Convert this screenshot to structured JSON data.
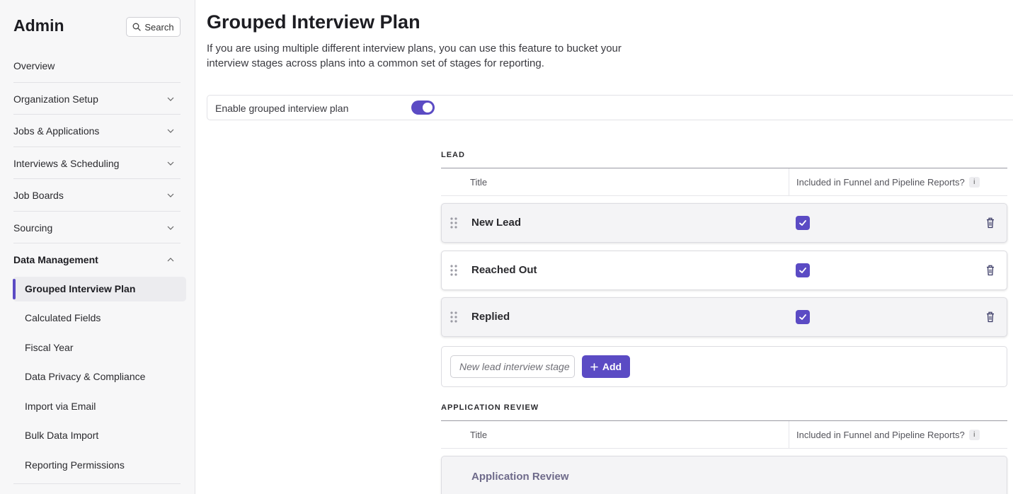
{
  "sidebar": {
    "title": "Admin",
    "search_label": "Search",
    "overview": "Overview",
    "sections": [
      {
        "label": "Organization Setup",
        "expanded": false
      },
      {
        "label": "Jobs & Applications",
        "expanded": false
      },
      {
        "label": "Interviews & Scheduling",
        "expanded": false
      },
      {
        "label": "Job Boards",
        "expanded": false
      },
      {
        "label": "Sourcing",
        "expanded": false
      },
      {
        "label": "Data Management",
        "expanded": true
      }
    ],
    "sub_items": [
      {
        "label": "Grouped Interview Plan",
        "active": true
      },
      {
        "label": "Calculated Fields"
      },
      {
        "label": "Fiscal Year"
      },
      {
        "label": "Data Privacy & Compliance"
      },
      {
        "label": "Import via Email"
      },
      {
        "label": "Bulk Data Import"
      },
      {
        "label": "Reporting Permissions"
      }
    ]
  },
  "main": {
    "title": "Grouped Interview Plan",
    "description": "If you are using multiple different interview plans, you can use this feature to bucket your interview stages across plans into a common set of stages for reporting.",
    "toggle": {
      "label": "Enable grouped interview plan",
      "enabled": true
    },
    "groups": [
      {
        "name": "LEAD",
        "col_title": "Title",
        "col_included": "Included in Funnel and Pipeline Reports?",
        "info_badge": "i",
        "stages": [
          {
            "name": "New Lead",
            "included": true
          },
          {
            "name": "Reached Out",
            "included": true
          },
          {
            "name": "Replied",
            "included": true
          }
        ],
        "add_placeholder": "New lead interview stage",
        "add_label": "Add"
      },
      {
        "name": "APPLICATION REVIEW",
        "col_title": "Title",
        "col_included": "Included in Funnel and Pipeline Reports?",
        "info_badge": "i",
        "stages": [
          {
            "name": "Application Review"
          }
        ]
      }
    ]
  },
  "colors": {
    "accent": "#5b4bc4",
    "sidebar_bg": "#f7f7f8",
    "faded_stage_text": "#6e6a8a"
  }
}
